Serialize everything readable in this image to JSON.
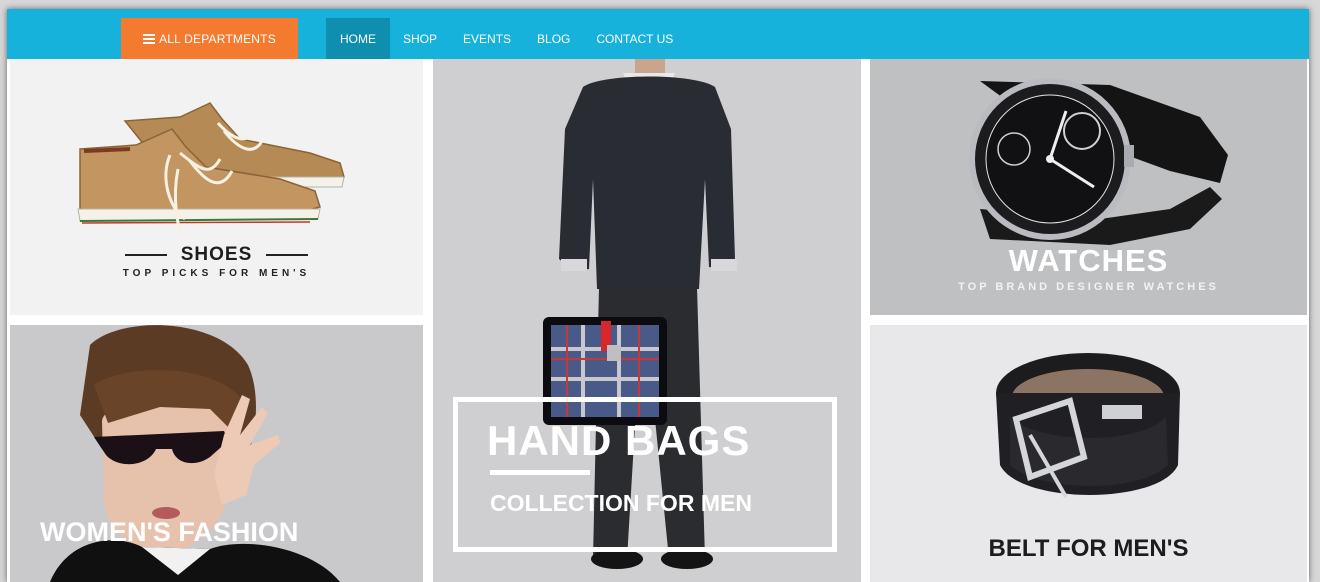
{
  "nav": {
    "departments_label": "ALL DEPARTMENTS",
    "items": [
      {
        "label": "HOME",
        "active": true
      },
      {
        "label": "SHOP"
      },
      {
        "label": "EVENTS"
      },
      {
        "label": "BLOG"
      },
      {
        "label": "CONTACT US"
      }
    ]
  },
  "tiles": {
    "shoes": {
      "title": "SHOES",
      "subtitle": "TOP PICKS FOR MEN'S"
    },
    "bags": {
      "title": "HAND BAGS",
      "subtitle": "COLLECTION FOR MEN"
    },
    "watches": {
      "title": "WATCHES",
      "subtitle": "TOP BRAND DESIGNER WATCHES"
    },
    "women": {
      "title": "WOMEN'S FASHION"
    },
    "belt": {
      "title": "BELT FOR MEN'S"
    }
  },
  "colors": {
    "nav_bar": "#16b2dc",
    "nav_active": "#0f8fb0",
    "departments_button": "#f47a2f"
  }
}
